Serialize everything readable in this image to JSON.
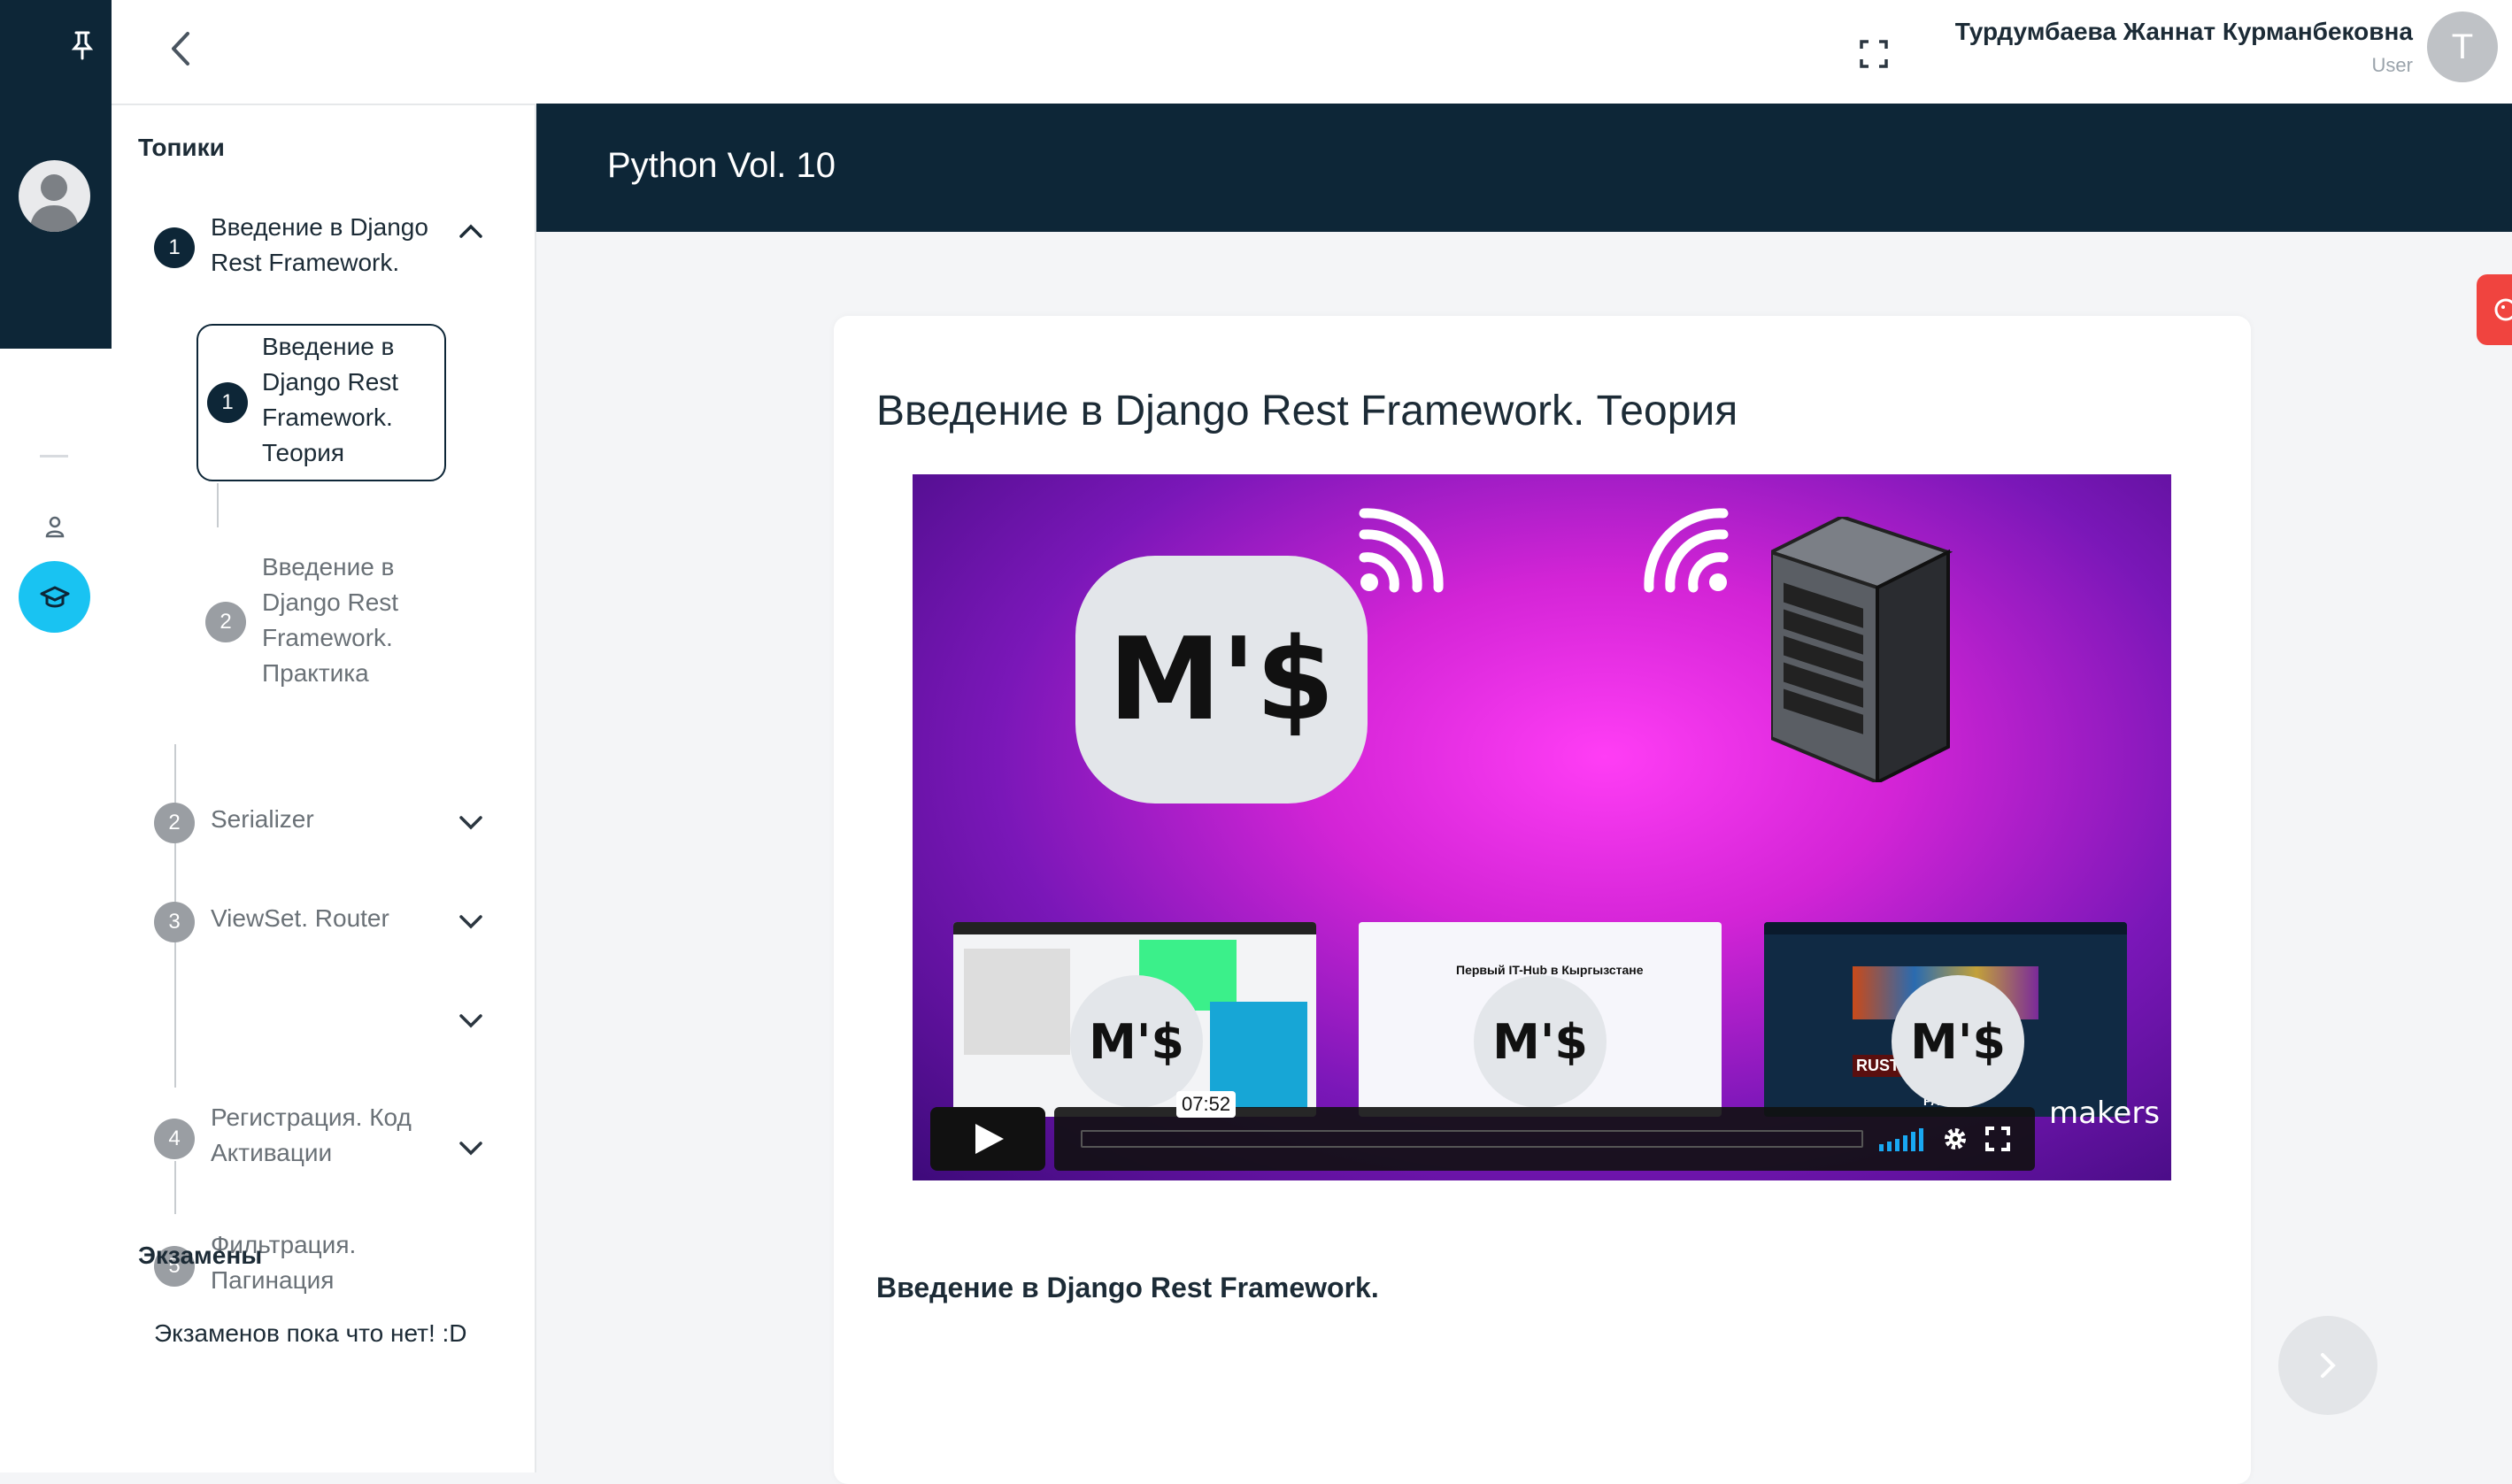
{
  "header": {
    "user_name": "Турдумбаева Жаннат Курманбековна",
    "user_role": "User",
    "user_initial": "T"
  },
  "sidebar": {
    "topics_heading": "Топики",
    "topics": [
      {
        "num": "1",
        "title_lines": [
          "Введение в Django",
          "Rest Framework."
        ],
        "expanded": true,
        "lessons": [
          {
            "num": "1",
            "lines": [
              "Введение в",
              "Django Rest",
              "Framework.",
              "Теория"
            ],
            "active": true
          },
          {
            "num": "2",
            "lines": [
              "Введение в",
              "Django Rest",
              "Framework.",
              "Практика"
            ],
            "active": false
          }
        ]
      },
      {
        "num": "2",
        "title_lines": [
          "Serializer"
        ]
      },
      {
        "num": "3",
        "title_lines": [
          "ViewSet. Router"
        ]
      },
      {
        "num": "4",
        "title_lines": [
          "Регистрация. Код",
          "Активации"
        ]
      },
      {
        "num": "5",
        "title_lines": [
          "Фильтрация.",
          "Пагинация"
        ]
      }
    ],
    "exams_heading": "Экзамены",
    "no_exams": "Экзаменов пока что нет! :D"
  },
  "main": {
    "course_title": "Python Vol. 10",
    "lesson_heading": "Введение в Django Rest Framework. Теория",
    "lesson_subheading": "Введение в Django Rest Framework.",
    "video": {
      "logo_text": "M'$",
      "thumb_caption": "Первый IT-Hub в Кыргызстане",
      "rust_label": "RUST",
      "pavlov_label": "PAVLOV",
      "time_label": "07:52",
      "watermark": "makers",
      "progress": 0
    }
  },
  "colors": {
    "navy": "#0d2637",
    "accent": "#19c3f2",
    "feedback": "#f0443f"
  }
}
